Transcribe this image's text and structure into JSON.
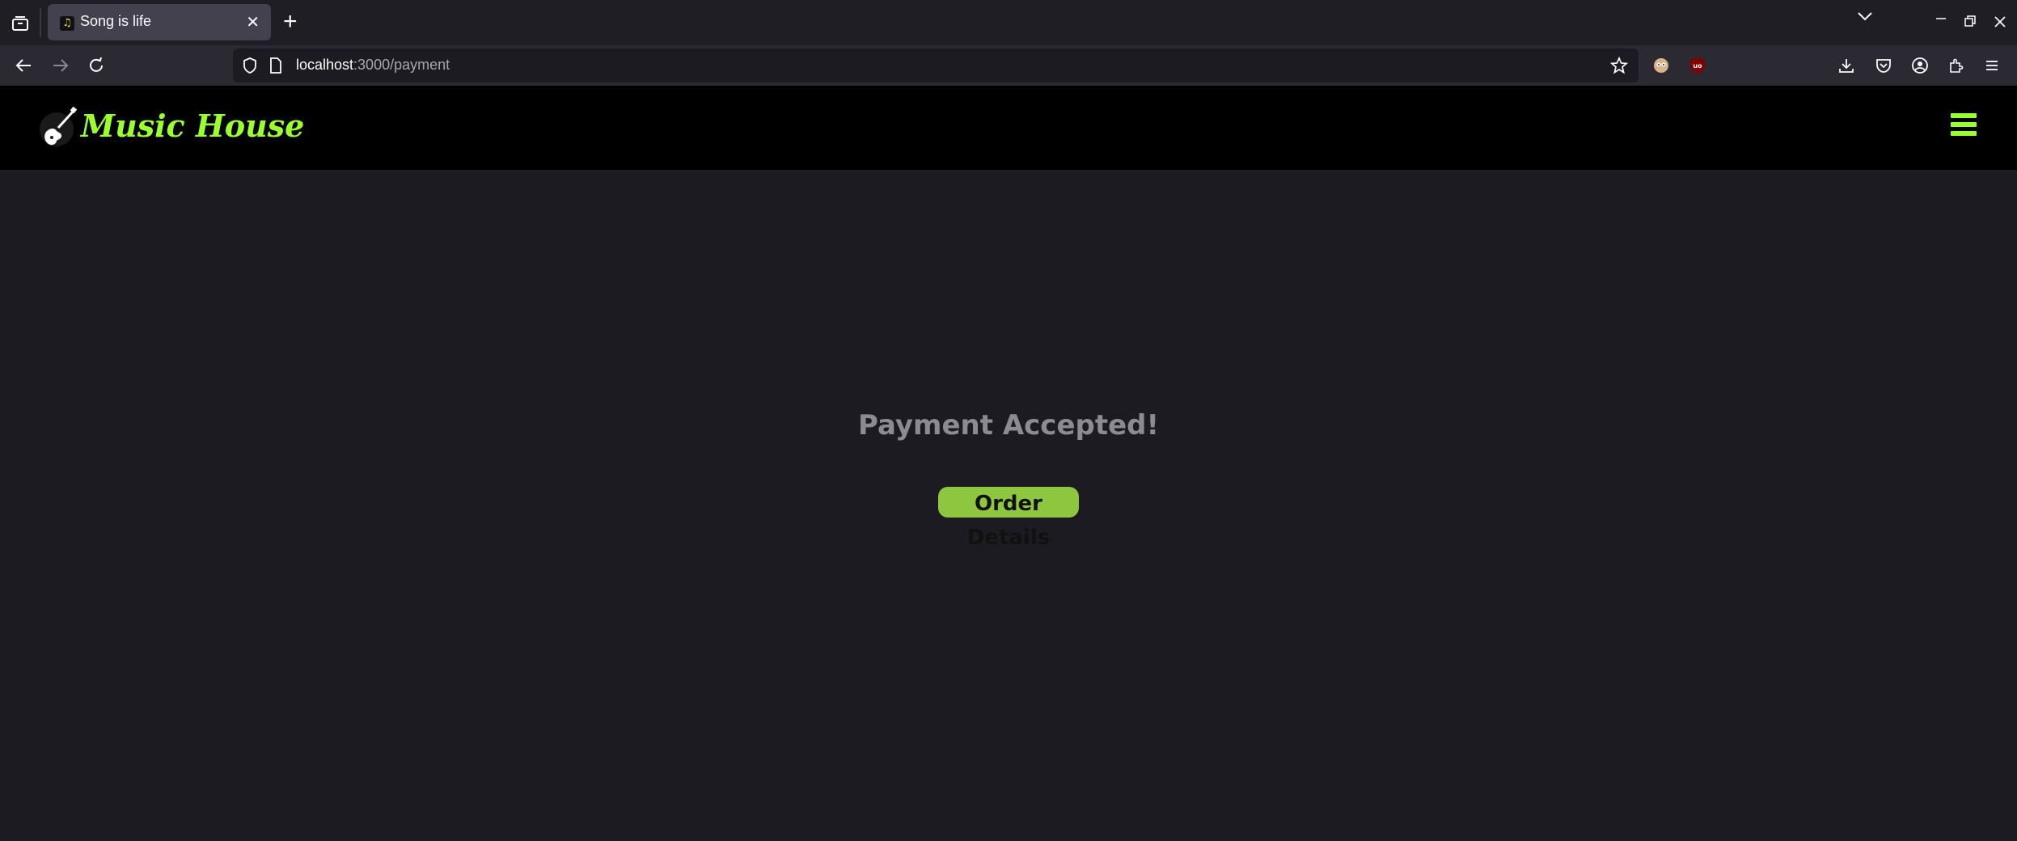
{
  "browser": {
    "tab_title": "Song is life",
    "tab_close": "✕",
    "new_tab": "+",
    "url_host": "localhost",
    "url_path": ":3000/payment"
  },
  "site": {
    "brand": "Music House"
  },
  "main": {
    "message": "Payment Accepted!",
    "order_button": "Order Details"
  },
  "colors": {
    "accent": "#9cff2e",
    "button": "#8ec63f",
    "page_bg": "#1c1b22",
    "header_bg": "#000000"
  }
}
